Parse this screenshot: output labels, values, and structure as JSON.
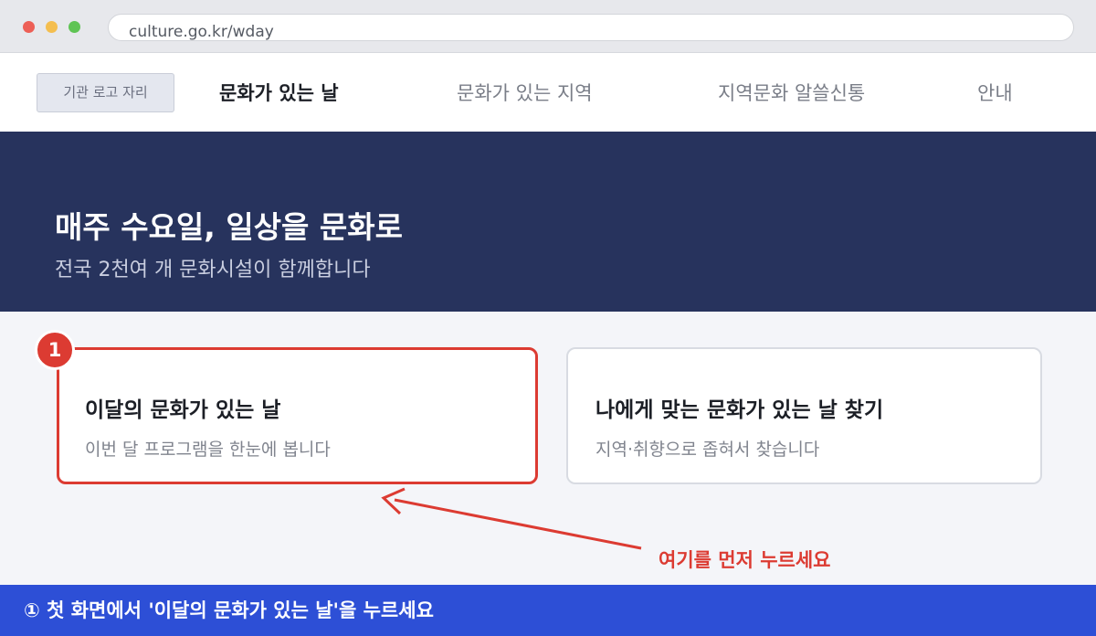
{
  "browser": {
    "url": "culture.go.kr/wday"
  },
  "nav": {
    "logo_placeholder": "기관 로고 자리",
    "items": [
      {
        "label": "문화가 있는 날",
        "active": true
      },
      {
        "label": "문화가 있는 지역",
        "active": false
      },
      {
        "label": "지역문화 알쓸신통",
        "active": false
      },
      {
        "label": "안내",
        "active": false
      }
    ]
  },
  "hero": {
    "title": "매주 수요일, 일상을 문화로",
    "subtitle": "전국 2천여 개 문화시설이 함께합니다"
  },
  "cards": [
    {
      "title": "이달의 문화가 있는 날",
      "description": "이번 달 프로그램을 한눈에 봅니다",
      "highlighted": true
    },
    {
      "title": "나에게 맞는 문화가 있는 날 찾기",
      "description": "지역·취향으로 좁혀서 찾습니다",
      "highlighted": false
    }
  ],
  "annotation": {
    "step_number": "1",
    "callout_text": "여기를 먼저 누르세요",
    "accent_color": "#dc3b32"
  },
  "instruction_banner": {
    "text": "① 첫 화면에서 '이달의 문화가 있는 날'을 누르세요",
    "color": "#2d4fd6"
  },
  "colors": {
    "hero_background": "#27335d",
    "page_background": "#f4f5f9"
  }
}
